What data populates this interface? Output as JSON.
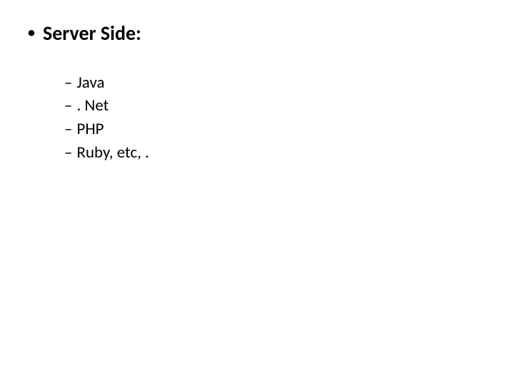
{
  "main": {
    "bullet": "•",
    "title": "Server Side:"
  },
  "sub": {
    "dash": "–",
    "items": [
      {
        "label": "Java"
      },
      {
        "label": ". Net"
      },
      {
        "label": "PHP"
      },
      {
        "label": "Ruby, etc, ."
      }
    ]
  }
}
